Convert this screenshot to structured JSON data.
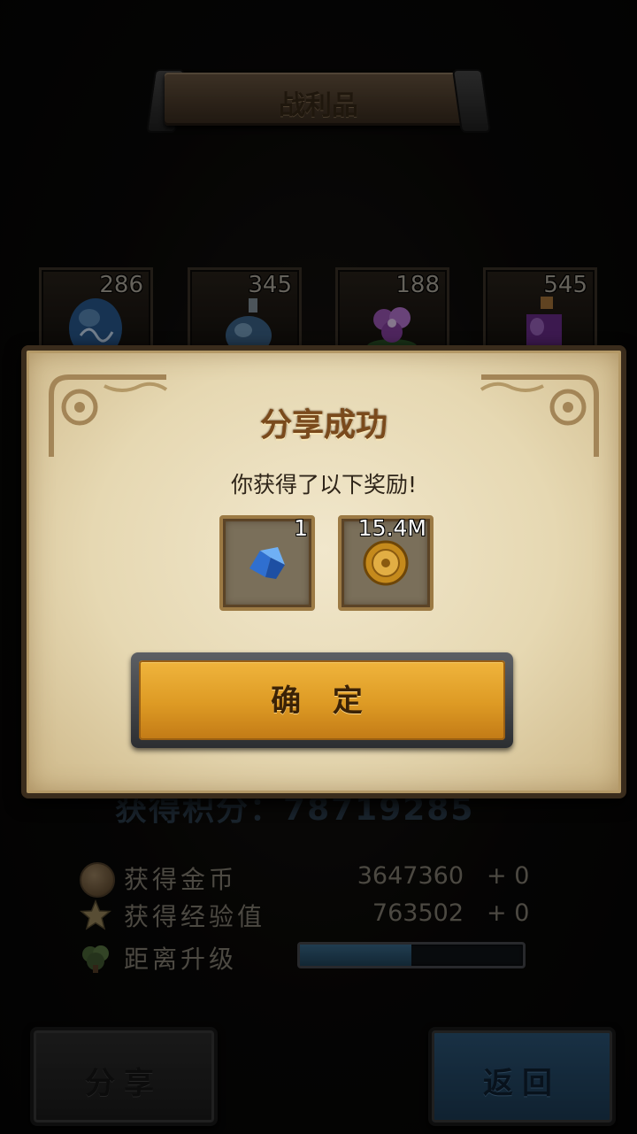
{
  "header": {
    "title": "战利品"
  },
  "loot": [
    {
      "count": "286",
      "icon": "blue-egg-icon"
    },
    {
      "count": "345",
      "icon": "potion-flask-icon"
    },
    {
      "count": "188",
      "icon": "purple-flower-icon"
    },
    {
      "count": "545",
      "icon": "purple-potion-bottle-icon"
    }
  ],
  "summary": {
    "score_label": "获得积分：",
    "score_value": "78719285",
    "gold": {
      "label": "获得金币",
      "value": "3647360",
      "delta": "+ 0",
      "icon": "coin-icon"
    },
    "exp": {
      "label": "获得经验值",
      "value": "763502",
      "delta": "+ 0",
      "icon": "star-icon"
    },
    "level": {
      "label": "距离升级",
      "progress": 0.5,
      "icon": "tree-icon"
    }
  },
  "buttons": {
    "share": "分享",
    "back": "返回"
  },
  "dialog": {
    "title": "分享成功",
    "message": "你获得了以下奖励!",
    "rewards": [
      {
        "count": "1",
        "icon": "blue-crystal-icon"
      },
      {
        "count": "15.4M",
        "icon": "gold-coin-icon"
      }
    ],
    "confirm": "确 定"
  },
  "colors": {
    "accent_gold": "#dd9a24",
    "parchment": "#e6d8b2",
    "title_brown": "#7a4a1c",
    "back_blue": "#2e5a7e"
  }
}
